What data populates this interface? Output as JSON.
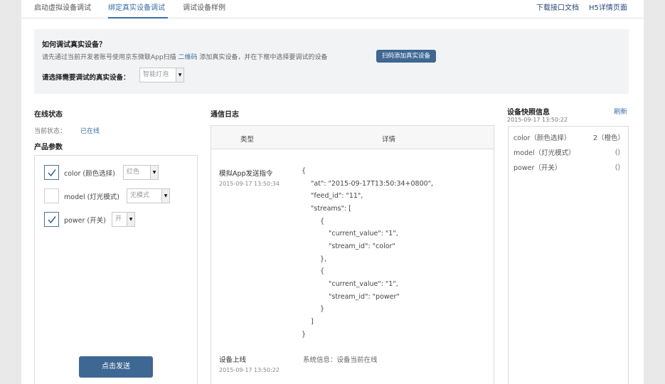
{
  "tabs": [
    {
      "label": "启动虚拟设备调试"
    },
    {
      "label": "绑定真实设备调试"
    },
    {
      "label": "调试设备样例"
    }
  ],
  "links": {
    "api_doc": "下载接口文档",
    "h5_page": "H5详情页面"
  },
  "help": {
    "title": "如何调试真实设备？",
    "desc_before": "请先通过当前开发者账号使用京东微联App扫描",
    "desc_link": "二维码",
    "desc_after": "添加真实设备，并在下框中选择要调试的设备",
    "scan_button": "扫码添加真实设备",
    "select_label": "请选择需要调试的真实设备：",
    "select_value": "智能灯泡"
  },
  "online": {
    "title": "在线状态",
    "label": "当前状态：",
    "value": "已在线"
  },
  "params": {
    "title": "产品参数",
    "items": [
      {
        "label": "color (颜色选择)",
        "value": "红色",
        "checked": true
      },
      {
        "label": "model (灯光模式)",
        "value": "无模式",
        "checked": false
      },
      {
        "label": "power (开关)",
        "value": "开",
        "checked": true
      }
    ],
    "send_button": "点击发送"
  },
  "log": {
    "title": "通信日志",
    "col_type": "类型",
    "col_detail": "详情",
    "entries": [
      {
        "type": "模拟App发送指令",
        "time": "2015-09-17 13:50:34",
        "json_lines": [
          "{",
          "\"at\": \"2015-09-17T13:50:34+0800\",",
          "\"feed_id\": \"11\",",
          "\"streams\": [",
          "{",
          "\"current_value\": \"1\",",
          "\"stream_id\": \"color\"",
          "},",
          "{",
          "\"current_value\": \"1\",",
          "\"stream_id\": \"power\"",
          "}",
          "]",
          "}"
        ]
      },
      {
        "type": "设备上线",
        "time": "2015-09-17 13:50:22",
        "message": "系统信息：设备当前在线"
      }
    ]
  },
  "snapshot": {
    "title": "设备快照信息",
    "refresh": "刷新",
    "time": "2015-09-17 13:50:22",
    "rows": [
      {
        "key": "color（颜色选择）",
        "value": "2（橙色）"
      },
      {
        "key": "model（灯光模式）",
        "value": "（）"
      },
      {
        "key": "power（开关）",
        "value": "（）"
      }
    ]
  },
  "colors": {
    "accent": "#3e6793",
    "link": "#3a6ea5",
    "panel_bg": "#f2f3f5"
  }
}
